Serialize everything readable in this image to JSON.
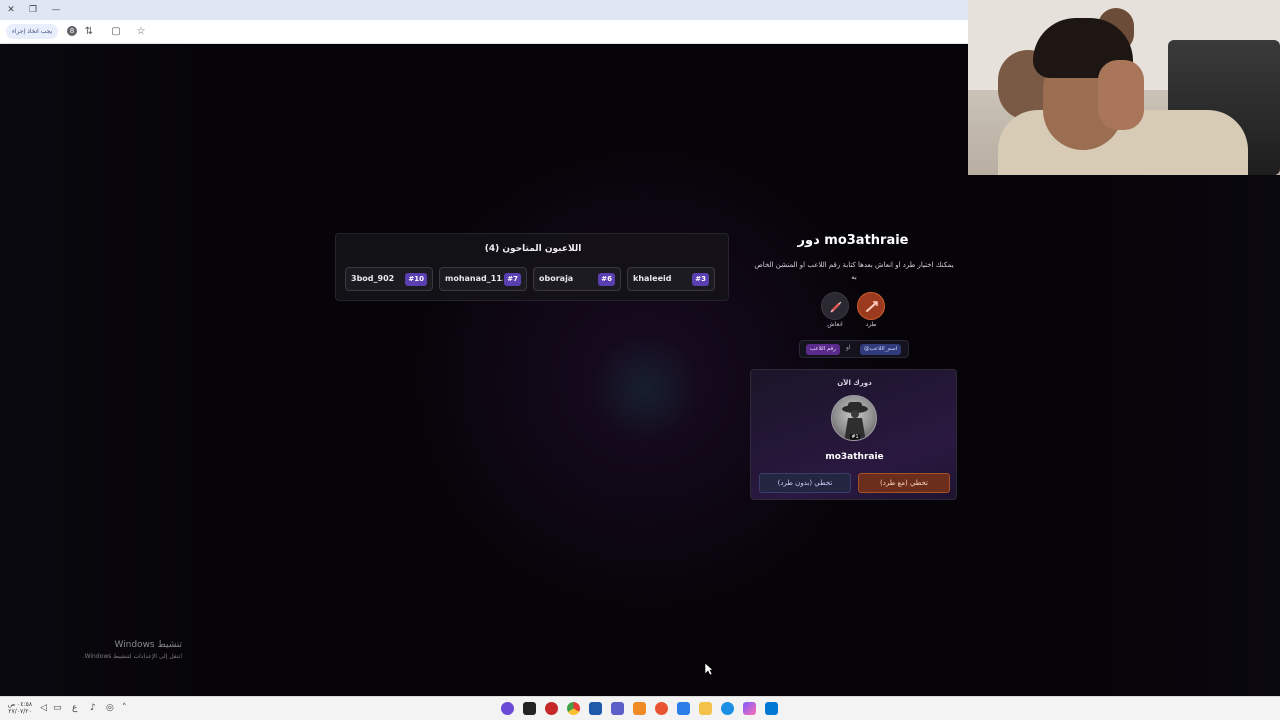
{
  "browser": {
    "bookmark_pill": "يجب اتخاذ إجراء",
    "profile_badge": "8"
  },
  "players_panel": {
    "title": "اللاعبون المتاحون (4)",
    "players": [
      {
        "name": "3bod_902",
        "number": "#10"
      },
      {
        "name": "mohanad_11...",
        "number": "#7"
      },
      {
        "name": "oboraja",
        "number": "#6"
      },
      {
        "name": "khaleeid",
        "number": "#3"
      }
    ]
  },
  "turn_panel": {
    "title": "دور mo3athraie",
    "description": "يمكنك اختيار طرد او انعاش بعدها كتابة رقم اللاعب او المنشن الخاص به",
    "actions": [
      {
        "label": "طرد",
        "icon": "kick-icon"
      },
      {
        "label": "انعاش",
        "icon": "revive-syringe-icon"
      }
    ],
    "chip_name": "@اسم_اللاعب",
    "or_word": "او",
    "chip_number": "رقم اللاعب"
  },
  "current_turn": {
    "label": "دورك الآن",
    "player_name": "mo3athraie",
    "avatar_badge": "#1",
    "skip_with_kick": "تخطي (مع طرد)",
    "skip_without_kick": "تخطي (بدون طرد)"
  },
  "windows_watermark": {
    "line1": "تنشيط Windows",
    "line2": "انتقل إلى الإعدادات لتنشيط Windows."
  },
  "taskbar": {
    "time": "٠٤:٥٨ ص",
    "date": "٢٧/٠٧/٢٠",
    "lang": "ع"
  },
  "colors": {
    "accent_purple": "#5a3fb0",
    "kick_orange": "#9b3a1e",
    "page_bg": "#060408"
  }
}
